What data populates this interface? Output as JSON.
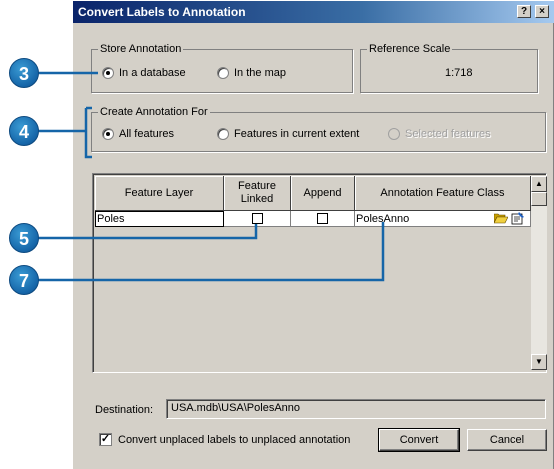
{
  "dialog": {
    "title": "Convert Labels to Annotation",
    "help_button": "?",
    "close_button": "×"
  },
  "store_annotation": {
    "legend": "Store Annotation",
    "options": [
      {
        "label": "In a database",
        "checked": true
      },
      {
        "label": "In the map",
        "checked": false
      }
    ]
  },
  "reference_scale": {
    "legend": "Reference Scale",
    "value": "1:718"
  },
  "create_annotation_for": {
    "legend": "Create Annotation For",
    "options": [
      {
        "label": "All features",
        "checked": true,
        "enabled": true
      },
      {
        "label": "Features in current extent",
        "checked": false,
        "enabled": true
      },
      {
        "label": "Selected features",
        "checked": false,
        "enabled": false
      }
    ]
  },
  "grid": {
    "columns": [
      "Feature Layer",
      "Feature Linked",
      "Append",
      "Annotation Feature Class"
    ],
    "column_feature_linked_line1": "Feature",
    "column_feature_linked_line2": "Linked",
    "rows": [
      {
        "feature_layer": "Poles",
        "feature_linked": false,
        "append": false,
        "annotation_feature_class": "PolesAnno"
      }
    ]
  },
  "destination": {
    "label": "Destination:",
    "value": "USA.mdb\\USA\\PolesAnno"
  },
  "convert_unplaced": {
    "label": "Convert unplaced labels to unplaced annotation",
    "checked": true
  },
  "buttons": {
    "convert": "Convert",
    "cancel": "Cancel"
  },
  "callouts": [
    "3",
    "4",
    "5",
    "7"
  ],
  "colors": {
    "callout_blue": "#1565a8",
    "titlebar": "#0a246a",
    "dialog_face": "#d4d0c8"
  }
}
